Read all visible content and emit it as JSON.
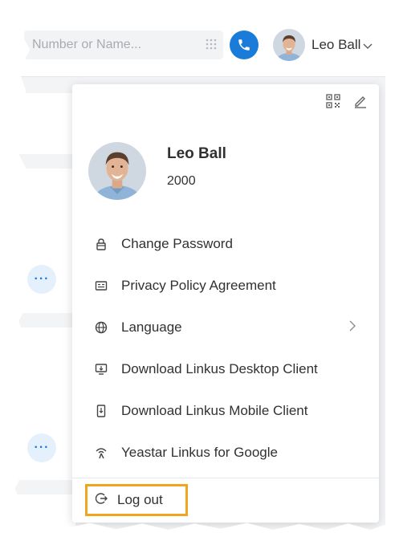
{
  "header": {
    "search_placeholder": "Number or Name...",
    "user_name": "Leo Ball"
  },
  "profile": {
    "name": "Leo Ball",
    "extension": "2000"
  },
  "menu": {
    "items": [
      {
        "label": "Change Password",
        "icon": "lock-icon"
      },
      {
        "label": "Privacy Policy Agreement",
        "icon": "agreement-card-icon"
      },
      {
        "label": "Language",
        "icon": "globe-icon",
        "has_submenu": true
      },
      {
        "label": "Download Linkus Desktop Client",
        "icon": "desktop-download-icon"
      },
      {
        "label": "Download Linkus Mobile Client",
        "icon": "mobile-download-icon"
      },
      {
        "label": "Yeastar Linkus for Google",
        "icon": "linkus-google-icon"
      }
    ],
    "logout_label": "Log out"
  },
  "background": {
    "more_button_label": "···"
  },
  "colors": {
    "accent": "#1a7cd8",
    "highlight_border": "#f0a51e",
    "more_button_bg": "#e4f0fb"
  }
}
